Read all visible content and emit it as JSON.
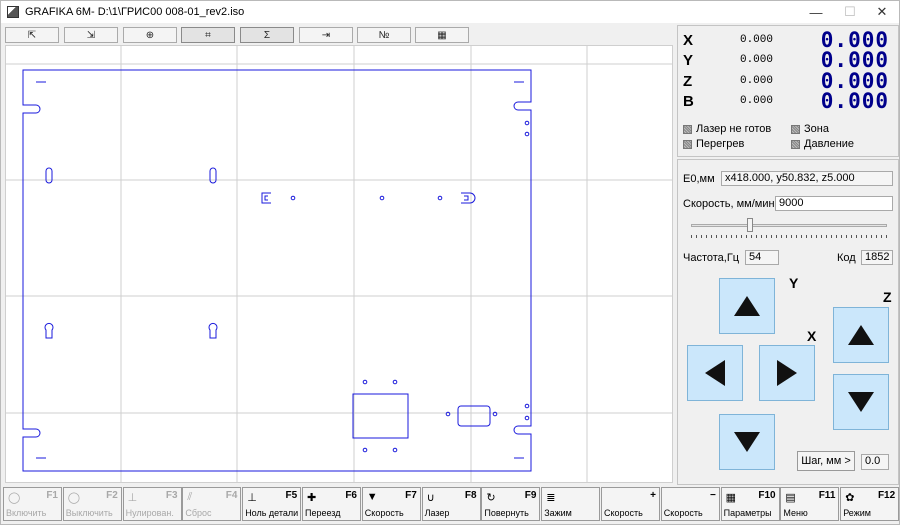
{
  "window": {
    "title": "GRAFIKA 6M- D:\\1\\ГРИС00 008-01_rev2.iso",
    "min_glyph": "—",
    "max_glyph": "☐",
    "close_glyph": "✕"
  },
  "toolbar": {
    "buttons": [
      "⇱",
      "⇲",
      "⊕",
      "⌗",
      "Σ",
      "⇥",
      "№",
      "▦"
    ]
  },
  "coords": [
    {
      "axis": "X",
      "small": "0.000",
      "big": "0.000"
    },
    {
      "axis": "Y",
      "small": "0.000",
      "big": "0.000"
    },
    {
      "axis": "Z",
      "small": "0.000",
      "big": "0.000"
    },
    {
      "axis": "B",
      "small": "0.000",
      "big": "0.000"
    }
  ],
  "status": {
    "laser_not_ready": "Лазер не готов",
    "zone": "Зона",
    "overheat": "Перегрев",
    "pressure": "Давление"
  },
  "params": {
    "e0_label": "E0,мм",
    "e0_value": "x418.000, y50.832, z5.000",
    "speed_label": "Скорость, мм/мин",
    "speed_value": "9000",
    "speed_slider": 0.3,
    "freq_label": "Частота,Гц",
    "freq_value": "54",
    "code_label": "Код",
    "code_value": "1852"
  },
  "jog": {
    "y_label": "Y",
    "x_label": "X",
    "z_label": "Z",
    "step_button": "Шаг, мм >",
    "step_value": "0.0"
  },
  "fkeys": [
    {
      "key": "F1",
      "label": "Включить",
      "icon": "◯",
      "disabled": true
    },
    {
      "key": "F2",
      "label": "Выключить",
      "icon": "◯",
      "disabled": true
    },
    {
      "key": "F3",
      "label": "Нулирован.",
      "icon": "⊥",
      "disabled": true
    },
    {
      "key": "F4",
      "label": "Сброс",
      "icon": "⫽",
      "disabled": true
    },
    {
      "key": "F5",
      "label": "Ноль детали",
      "icon": "⊥",
      "disabled": false
    },
    {
      "key": "F6",
      "label": "Переезд",
      "icon": "✚",
      "disabled": false
    },
    {
      "key": "F7",
      "label": "Скорость",
      "icon": "▼",
      "disabled": false
    },
    {
      "key": "F8",
      "label": "Лазер",
      "icon": "∪",
      "disabled": false
    },
    {
      "key": "F9",
      "label": "Повернуть",
      "icon": "↻",
      "disabled": false
    },
    {
      "key": "",
      "label": "Зажим",
      "icon": "≣",
      "disabled": false
    },
    {
      "key": "+",
      "label": "Скорость",
      "icon": "",
      "disabled": false
    },
    {
      "key": "−",
      "label": "Скорость",
      "icon": "",
      "disabled": false
    },
    {
      "key": "F10",
      "label": "Параметры",
      "icon": "▦",
      "disabled": false
    },
    {
      "key": "F11",
      "label": "Меню",
      "icon": "▤",
      "disabled": false
    },
    {
      "key": "F12",
      "label": "Режим",
      "icon": "✿",
      "disabled": false
    }
  ]
}
